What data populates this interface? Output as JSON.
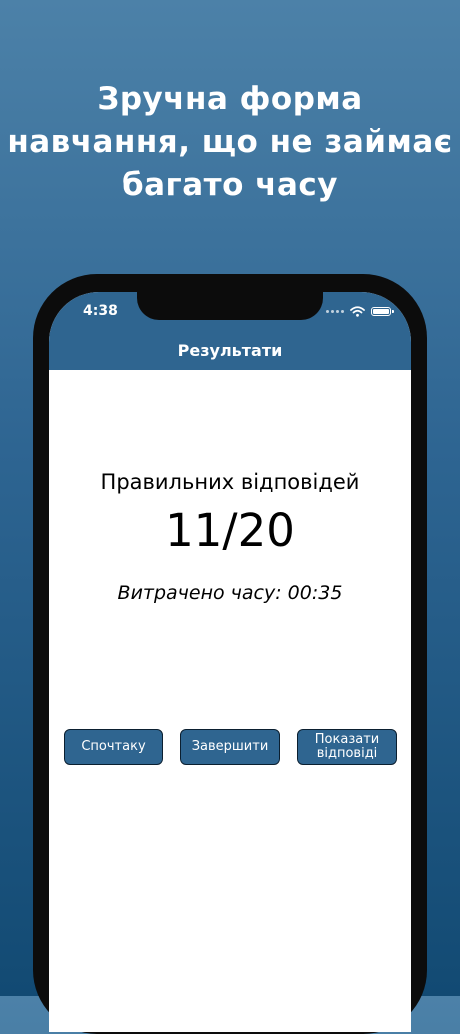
{
  "promo": {
    "line1": "Зручна форма",
    "line2": "навчання, що не займає",
    "line3": "багато часу"
  },
  "status_bar": {
    "time": "4:38"
  },
  "nav": {
    "title": "Результати"
  },
  "results": {
    "label": "Правильних відповідей",
    "score": "11/20",
    "time_spent": "Витрачено часу: 00:35"
  },
  "buttons": {
    "restart": "Спочтаку",
    "finish": "Завершити",
    "show_answers": "Показати відповіді"
  },
  "colors": {
    "accent": "#2f6590",
    "background_top": "#4c81a8",
    "background_bottom": "#124a73"
  },
  "icons": [
    "signal-dots-icon",
    "wifi-icon",
    "battery-icon"
  ]
}
